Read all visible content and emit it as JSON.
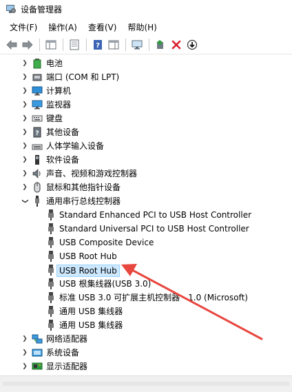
{
  "window": {
    "title": "设备管理器"
  },
  "menubar": [
    {
      "label": "文件(F)"
    },
    {
      "label": "操作(A)"
    },
    {
      "label": "查看(V)"
    },
    {
      "label": "帮助(H)"
    }
  ],
  "toolbar": {
    "buttons": [
      {
        "icon": "back-arrow-icon"
      },
      {
        "icon": "forward-arrow-icon"
      },
      {
        "icon": "show-hide-console-tree-icon"
      },
      {
        "icon": "properties-icon"
      },
      {
        "icon": "help-icon"
      },
      {
        "icon": "action-pane-icon"
      },
      {
        "icon": "scan-hardware-icon"
      },
      {
        "icon": "update-driver-icon"
      },
      {
        "icon": "uninstall-device-icon"
      },
      {
        "icon": "disable-device-icon"
      }
    ]
  },
  "tree": {
    "items": [
      {
        "label": "电池",
        "icon": "battery-icon",
        "expanded": false
      },
      {
        "label": "端口 (COM 和 LPT)",
        "icon": "port-icon",
        "expanded": false
      },
      {
        "label": "计算机",
        "icon": "computer-icon",
        "expanded": false
      },
      {
        "label": "监视器",
        "icon": "monitor-icon",
        "expanded": false
      },
      {
        "label": "键盘",
        "icon": "keyboard-icon",
        "expanded": false
      },
      {
        "label": "其他设备",
        "icon": "other-devices-icon",
        "expanded": false
      },
      {
        "label": "人体学输入设备",
        "icon": "hid-icon",
        "expanded": false
      },
      {
        "label": "软件设备",
        "icon": "software-device-icon",
        "expanded": false
      },
      {
        "label": "声音、视频和游戏控制器",
        "icon": "sound-icon",
        "expanded": false
      },
      {
        "label": "鼠标和其他指针设备",
        "icon": "mouse-icon",
        "expanded": false
      },
      {
        "label": "通用串行总线控制器",
        "icon": "usb-controller-icon",
        "expanded": true
      }
    ],
    "usb_children": [
      {
        "label": "Standard Enhanced PCI to USB Host Controller"
      },
      {
        "label": "Standard Universal PCI to USB Host Controller"
      },
      {
        "label": "USB Composite Device"
      },
      {
        "label": "USB Root Hub"
      },
      {
        "label": "USB Root Hub",
        "selected": true
      },
      {
        "label": "USB 根集线器(USB 3.0)"
      },
      {
        "label": "标准 USB 3.0 可扩展主机控制器 - 1.0 (Microsoft)"
      },
      {
        "label": "通用 USB 集线器"
      },
      {
        "label": "通用 USB 集线器"
      }
    ],
    "after_items": [
      {
        "label": "网络适配器",
        "icon": "network-adapter-icon",
        "expanded": false
      },
      {
        "label": "系统设备",
        "icon": "system-devices-icon",
        "expanded": false
      },
      {
        "label": "显示适配器",
        "icon": "display-adapter-icon",
        "expanded": false
      }
    ]
  },
  "colors": {
    "selection_bg": "#cce8ff",
    "selection_border": "#99d1ff",
    "annotation_arrow": "#e8473f"
  }
}
